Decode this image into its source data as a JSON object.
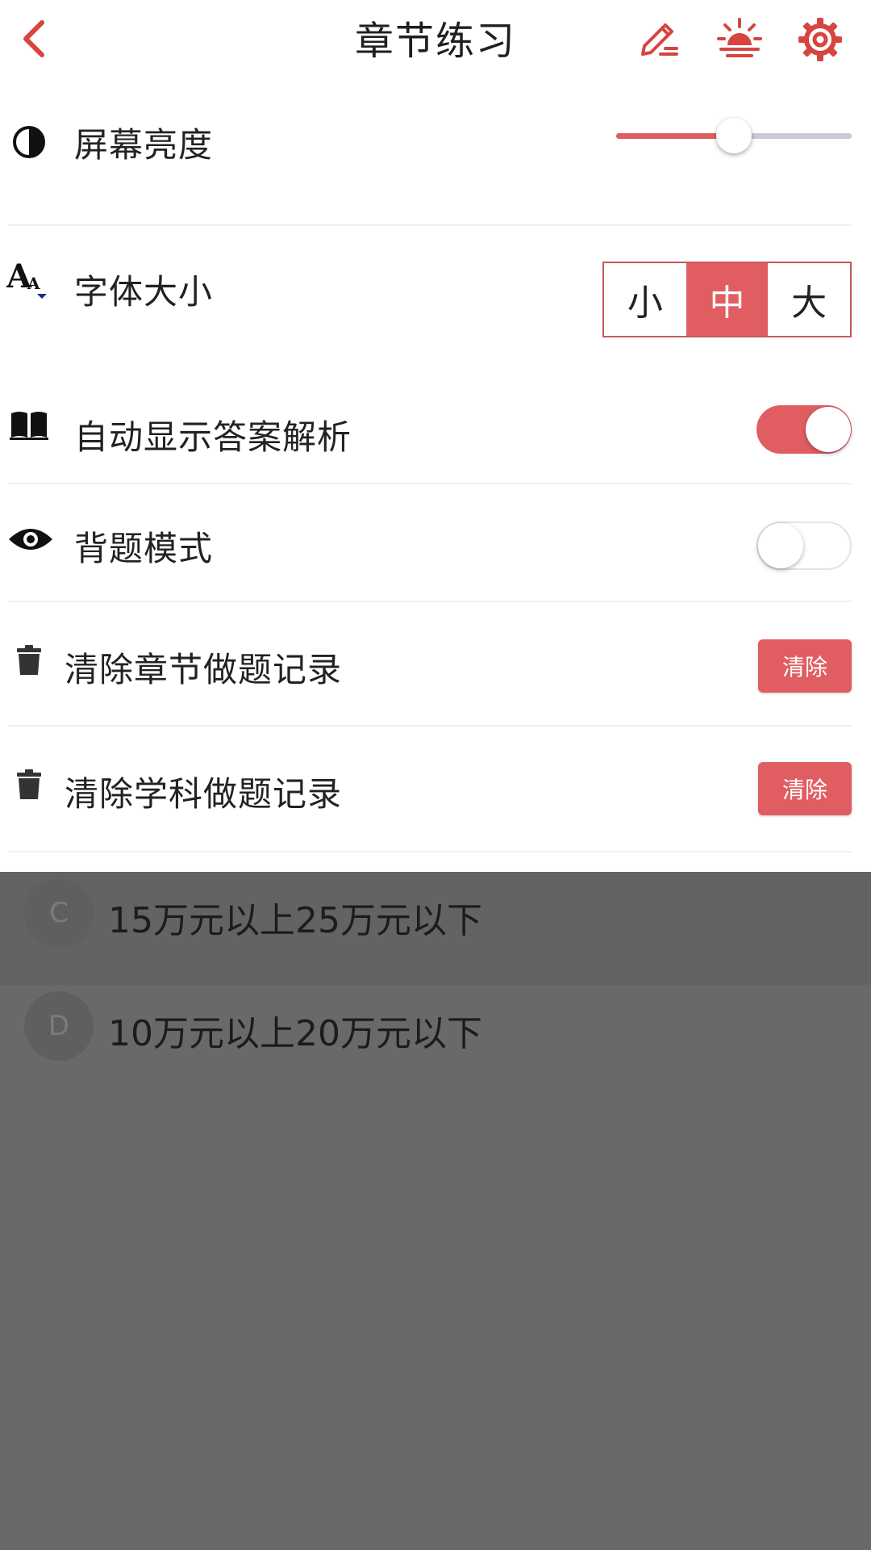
{
  "header": {
    "title": "章节练习"
  },
  "icons": {
    "back": "chevron-left-icon",
    "edit": "pencil-icon",
    "night": "sunrise-icon",
    "settings": "gear-icon"
  },
  "colors": {
    "accent": "#e05e62",
    "icon_red": "#d6453f",
    "overlay": "#696969"
  },
  "settings": {
    "brightness": {
      "label": "屏幕亮度",
      "value": 0.5
    },
    "font_size": {
      "label": "字体大小",
      "options": [
        "小",
        "中",
        "大"
      ],
      "selected": "中"
    },
    "auto_answer": {
      "label": "自动显示答案解析",
      "on": true
    },
    "recite_mode": {
      "label": "背题模式",
      "on": false
    },
    "clear_chapter": {
      "label": "清除章节做题记录",
      "button": "清除"
    },
    "clear_subject": {
      "label": "清除学科做题记录",
      "button": "清除"
    }
  },
  "options": [
    {
      "letter": "C",
      "text": "15万元以上25万元以下"
    },
    {
      "letter": "D",
      "text": "10万元以上20万元以下"
    }
  ]
}
